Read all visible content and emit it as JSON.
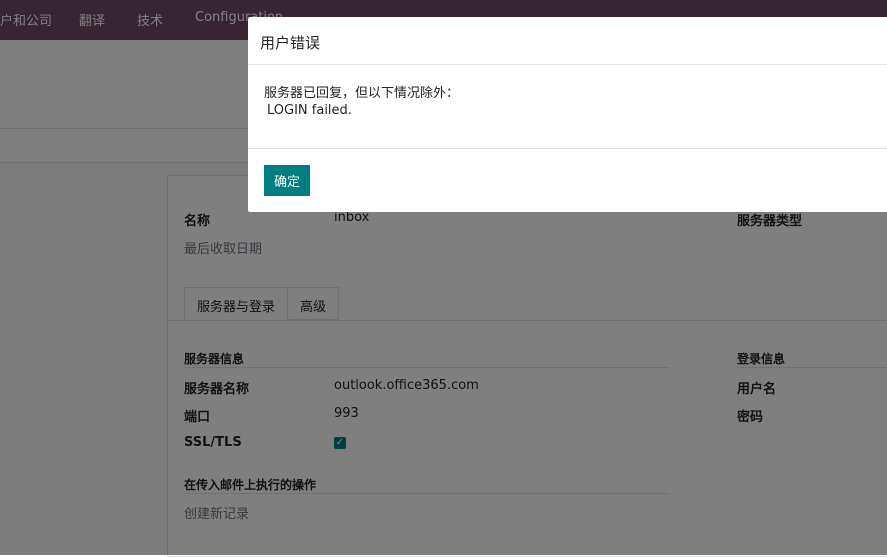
{
  "topbar": {
    "items": [
      "户和公司",
      "翻译",
      "技术",
      "Configuration"
    ]
  },
  "form": {
    "name_label": "名称",
    "name_value": "inbox",
    "last_fetch_label": "最后收取日期",
    "server_type_label": "服务器类型",
    "tabs": [
      "服务器与登录",
      "高级"
    ],
    "server_info_title": "服务器信息",
    "login_info_title": "登录信息",
    "server_name_label": "服务器名称",
    "server_name_value": "outlook.office365.com",
    "port_label": "端口",
    "port_value": "993",
    "ssl_label": "SSL/TLS",
    "ssl_checked": true,
    "username_label": "用户名",
    "password_label": "密码",
    "actions_title": "在传入邮件上执行的操作",
    "create_record_label": "创建新记录"
  },
  "dialog": {
    "title": "用户错误",
    "message_line1": "服务器已回复，但以下情况除外：",
    "message_line2": "LOGIN failed.",
    "ok_label": "确定"
  },
  "colors": {
    "topbar": "#714B67",
    "primary": "#017e84",
    "backdrop": "rgba(0,0,0,0.5)"
  }
}
